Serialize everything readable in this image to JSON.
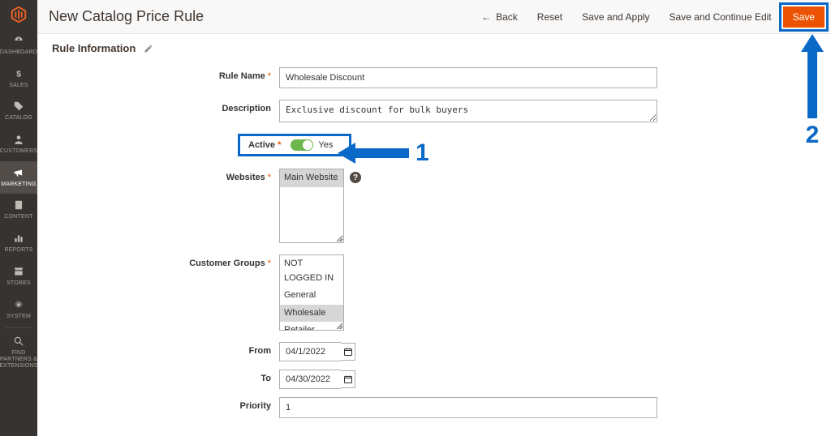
{
  "sidebar": {
    "items": [
      {
        "label": "DASHBOARD"
      },
      {
        "label": "SALES"
      },
      {
        "label": "CATALOG"
      },
      {
        "label": "CUSTOMERS"
      },
      {
        "label": "MARKETING"
      },
      {
        "label": "CONTENT"
      },
      {
        "label": "REPORTS"
      },
      {
        "label": "STORES"
      },
      {
        "label": "SYSTEM"
      },
      {
        "label": "FIND PARTNERS & EXTENSIONS"
      }
    ]
  },
  "header": {
    "title": "New Catalog Price Rule",
    "back": "Back",
    "reset": "Reset",
    "save_apply": "Save and Apply",
    "save_continue": "Save and Continue Edit",
    "save": "Save"
  },
  "section": {
    "title": "Rule Information"
  },
  "form": {
    "rule_name": {
      "label": "Rule Name",
      "value": "Wholesale Discount"
    },
    "description": {
      "label": "Description",
      "value": "Exclusive discount for bulk buyers"
    },
    "active": {
      "label": "Active",
      "state_text": "Yes"
    },
    "websites": {
      "label": "Websites",
      "options": [
        "Main Website"
      ],
      "selected": [
        0
      ],
      "help": "?"
    },
    "customer_groups": {
      "label": "Customer Groups",
      "options": [
        "NOT LOGGED IN",
        "General",
        "Wholesale",
        "Retailer"
      ],
      "selected": [
        2
      ]
    },
    "from": {
      "label": "From",
      "value": "04/1/2022"
    },
    "to": {
      "label": "To",
      "value": "04/30/2022"
    },
    "priority": {
      "label": "Priority",
      "value": "1"
    }
  },
  "annotations": {
    "one": "1",
    "two": "2"
  }
}
